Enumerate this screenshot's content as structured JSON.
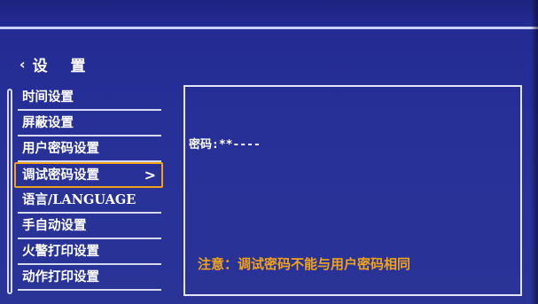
{
  "header": {
    "back_icon": "‹",
    "title": "设 置"
  },
  "menu": {
    "items": [
      {
        "label": "时间设置"
      },
      {
        "label": "屏蔽设置"
      },
      {
        "label": "用户密码设置"
      },
      {
        "label": "调试密码设置",
        "selected": true
      },
      {
        "label": "语言/LANGUAGE"
      },
      {
        "label": "手自动设置"
      },
      {
        "label": "火警打印设置"
      },
      {
        "label": "动作打印设置"
      }
    ],
    "selected_chevron": ">"
  },
  "panel": {
    "password_text": "密码:**----",
    "note": "注意：调试密码不能与用户密码相同"
  },
  "colors": {
    "background": "#263097",
    "highlight": "#f0a21a",
    "text": "#ffffff"
  }
}
